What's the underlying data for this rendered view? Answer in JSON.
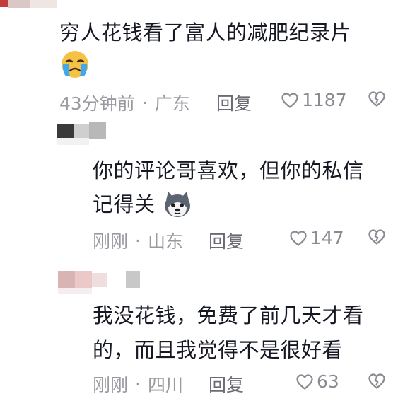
{
  "comments": [
    {
      "text_lines": [
        "穷人花钱看了富人的减肥纪录片"
      ],
      "emoji": "crying-face-emoji",
      "time": "43分钟前",
      "location": "广东",
      "reply_label": "回复",
      "likes": "1187"
    },
    {
      "text_lines": [
        "你的评论哥喜欢，但你的私信",
        "记得关"
      ],
      "emoji": "husky-dog-emoji",
      "time": "刚刚",
      "location": "山东",
      "reply_label": "回复",
      "likes": "147"
    },
    {
      "text_lines": [
        "我没花钱，免费了前几天才看",
        "的，而且我觉得不是很好看"
      ],
      "time": "刚刚",
      "location": "四川",
      "reply_label": "回复",
      "likes": "63"
    }
  ],
  "separator": "·",
  "colors": {
    "text": "#161823",
    "meta": "#9a9aa1",
    "icon": "#8a8a92"
  }
}
